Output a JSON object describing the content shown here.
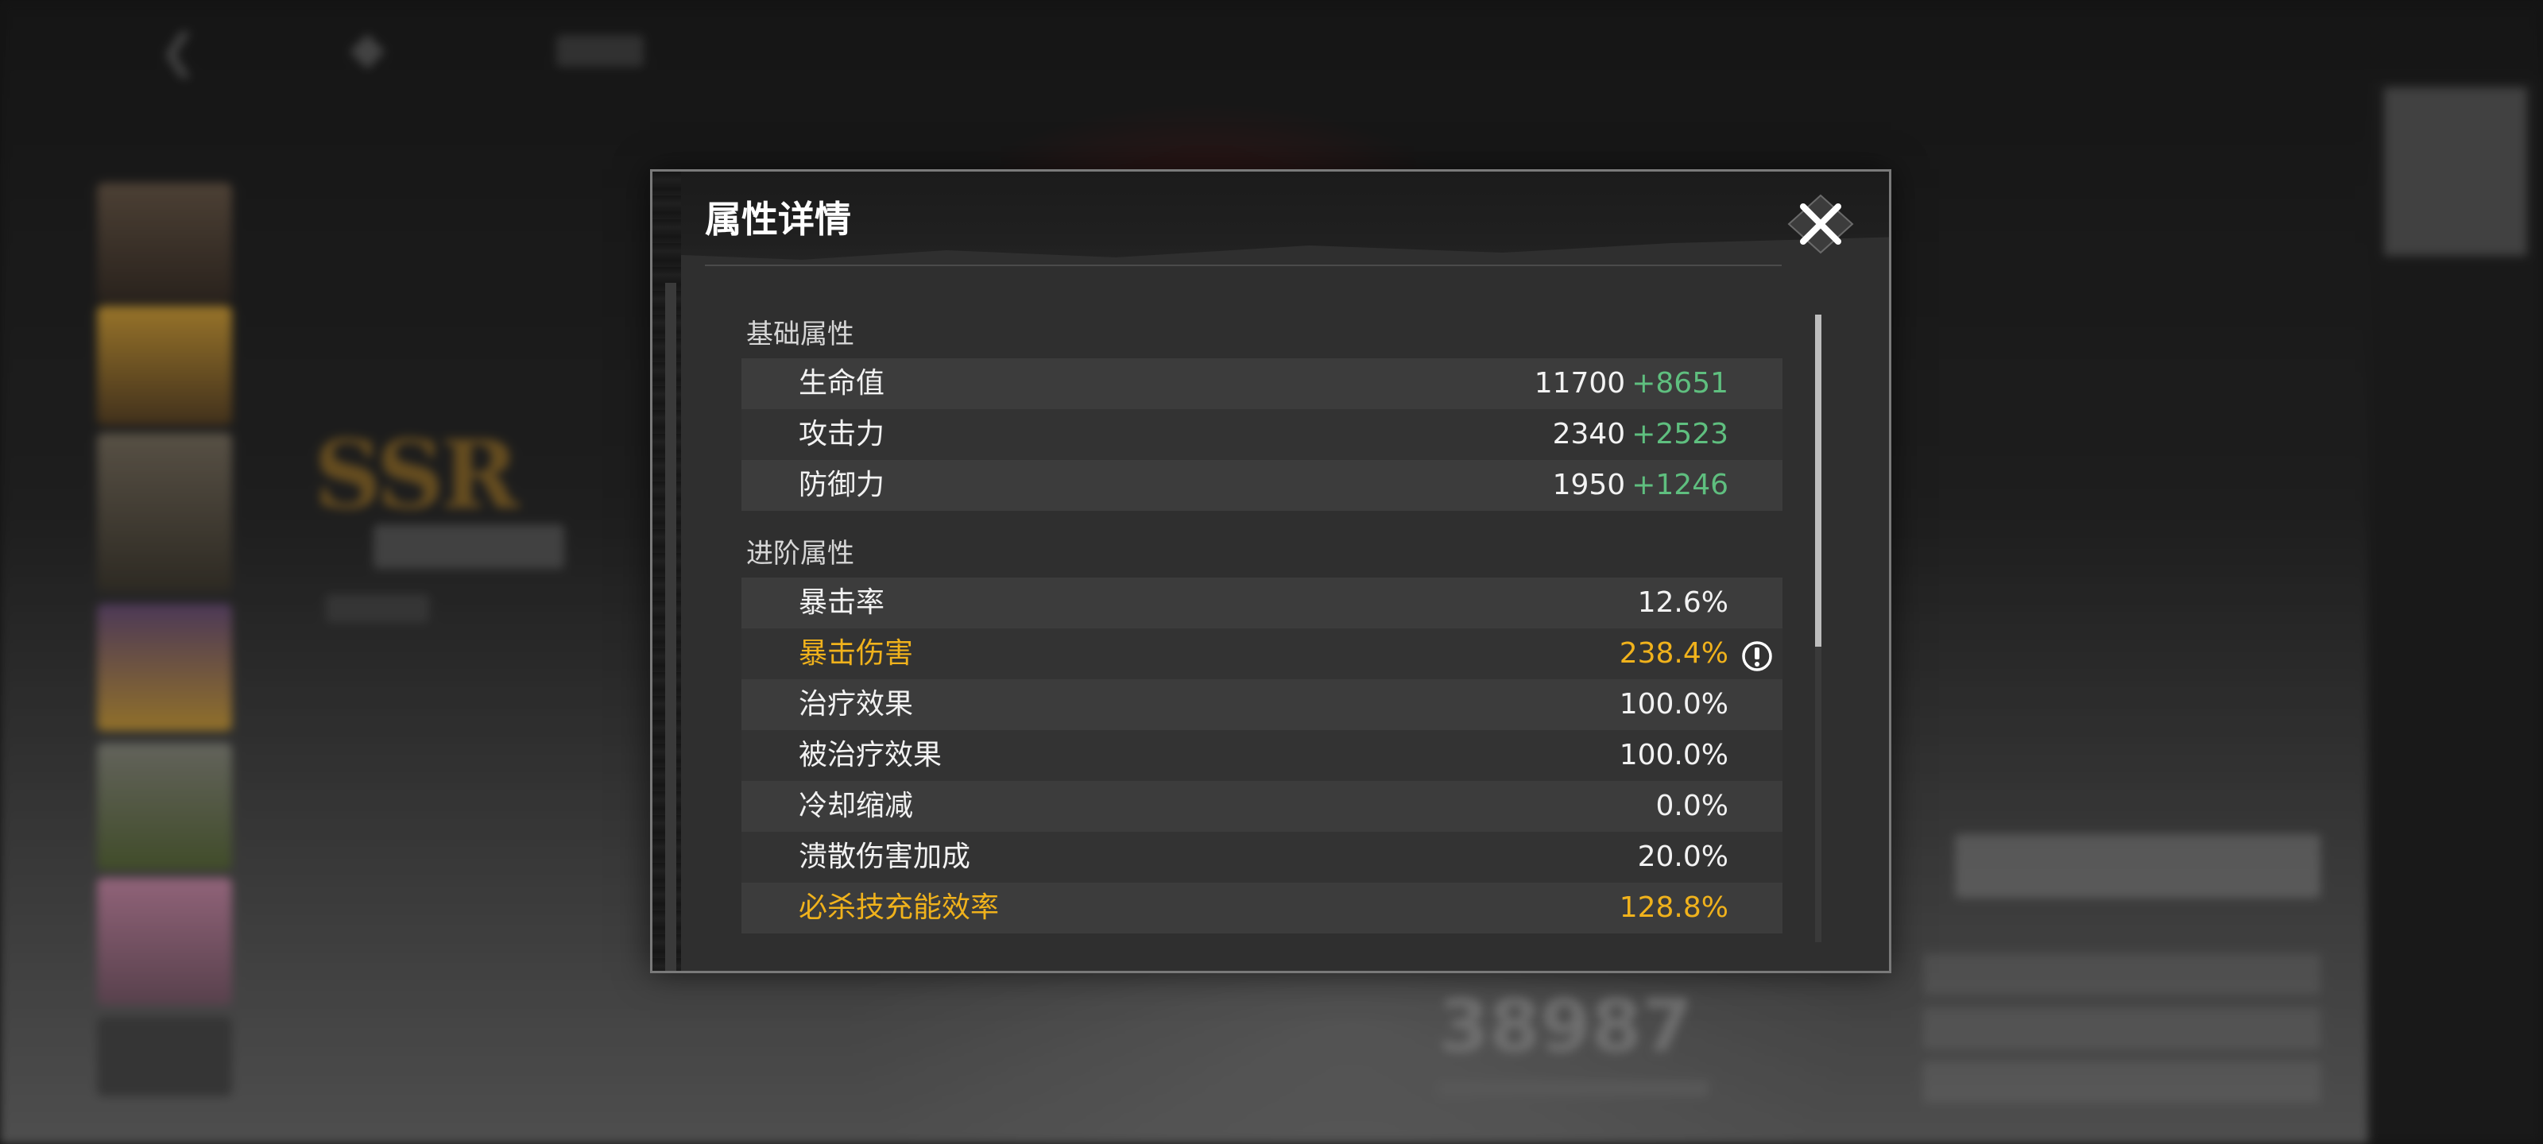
{
  "background": {
    "rarity_badge": "SSR",
    "score_value": "38987"
  },
  "dialog": {
    "title": "属性详情",
    "sections": [
      {
        "title": "基础属性",
        "rows": [
          {
            "name": "生命值",
            "value": "11700",
            "bonus": "+8651",
            "highlight": false
          },
          {
            "name": "攻击力",
            "value": "2340",
            "bonus": "+2523",
            "highlight": false
          },
          {
            "name": "防御力",
            "value": "1950",
            "bonus": "+1246",
            "highlight": false
          }
        ]
      },
      {
        "title": "进阶属性",
        "rows": [
          {
            "name": "暴击率",
            "value": "12.6%",
            "highlight": false
          },
          {
            "name": "暴击伤害",
            "value": "238.4%",
            "highlight": true,
            "warning": true
          },
          {
            "name": "治疗效果",
            "value": "100.0%",
            "highlight": false
          },
          {
            "name": "被治疗效果",
            "value": "100.0%",
            "highlight": false
          },
          {
            "name": "冷却缩减",
            "value": "0.0%",
            "highlight": false
          },
          {
            "name": "溃散伤害加成",
            "value": "20.0%",
            "highlight": false
          },
          {
            "name": "必杀技充能效率",
            "value": "128.8%",
            "highlight": true
          }
        ]
      }
    ]
  },
  "colors": {
    "highlight": "#f0b21c",
    "bonus": "#5fbf7f",
    "text": "#f2f2f2"
  },
  "icons": {
    "close": "close-x-icon",
    "warning": "exclamation-circle-icon",
    "back": "back-arrow-icon",
    "home": "home-icon"
  }
}
